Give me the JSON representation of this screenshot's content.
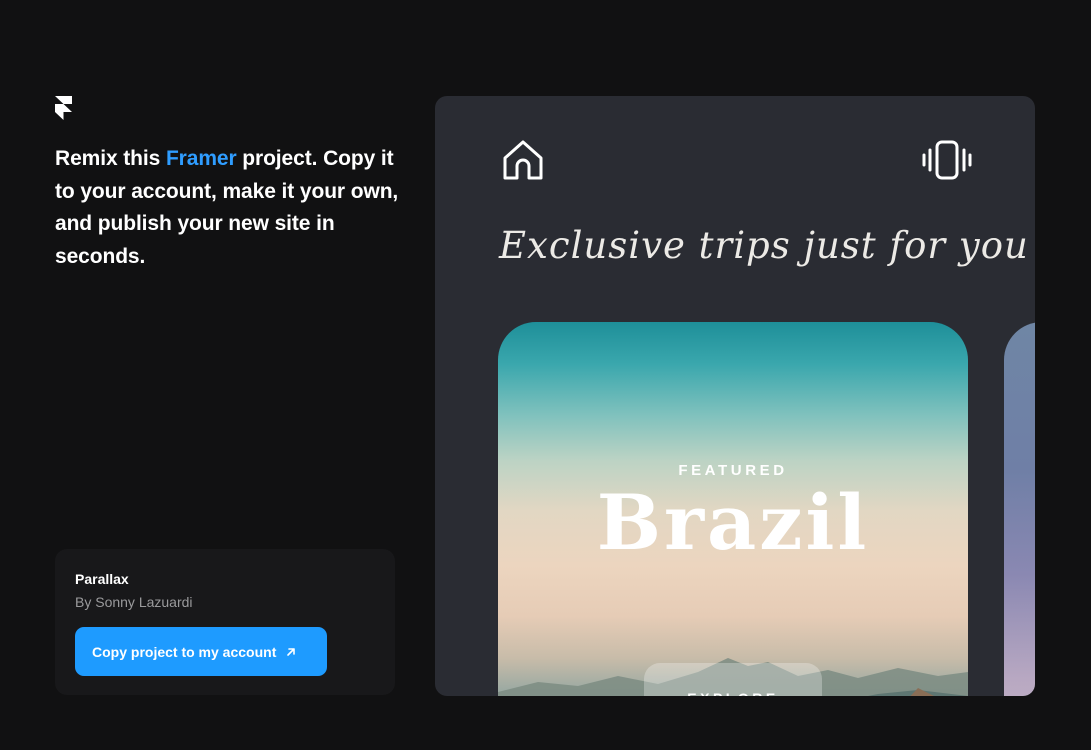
{
  "headline": {
    "before": "Remix this ",
    "brand": "Framer",
    "after": " project. Copy it to your account, make it your own, and publish your new site in seconds."
  },
  "project": {
    "title": "Parallax",
    "author": "By Sonny Lazuardi",
    "copy_button_label": "Copy project to my account"
  },
  "preview": {
    "tagline": "Exclusive trips just for you",
    "card": {
      "eyebrow": "FEATURED",
      "destination": "Brazil",
      "cta_label": "EXPLORE"
    }
  },
  "icons": {
    "logo": "framer-logo",
    "nav_left": "home-icon",
    "nav_right": "vibrate-icon",
    "button": "arrow-up-right-icon"
  },
  "colors": {
    "background": "#111112",
    "accent": "#1e9bff",
    "brand_text": "#2f9dff",
    "panel": "#2a2c33"
  }
}
